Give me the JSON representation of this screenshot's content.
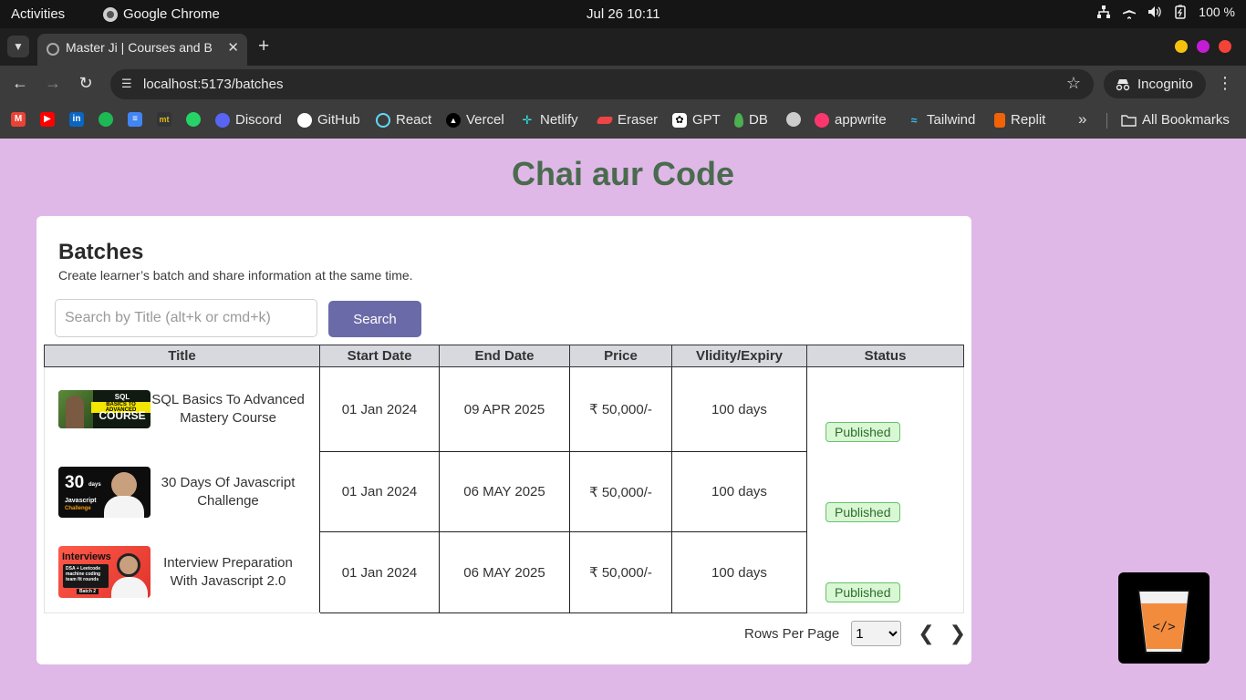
{
  "system": {
    "activities": "Activities",
    "app_name": "Google Chrome",
    "clock": "Jul 26  10:11",
    "battery": "100 %"
  },
  "browser": {
    "tab_title": "Master Ji | Courses and B",
    "url": "localhost:5173/batches",
    "incognito_label": "Incognito",
    "window_dot_colors": [
      "#f4c20d",
      "#c31cd4",
      "#f44336"
    ]
  },
  "bookmarks": {
    "items": [
      {
        "label": "Discord",
        "color": "#5865f2"
      },
      {
        "label": "GitHub",
        "color": "#ffffff"
      },
      {
        "label": "React",
        "color": "#61dafb"
      },
      {
        "label": "Vercel",
        "color": "#ffffff"
      },
      {
        "label": "Netlify",
        "color": "#32e6e2"
      },
      {
        "label": "Eraser",
        "color": "#ef4444"
      },
      {
        "label": "GPT",
        "color": "#ffffff"
      },
      {
        "label": "DB",
        "color": "#4caf50"
      },
      {
        "label": "appwrite",
        "color": "#fd366e"
      },
      {
        "label": "Tailwind",
        "color": "#38bdf8"
      },
      {
        "label": "Replit",
        "color": "#f26207"
      }
    ],
    "all_bookmarks": "All Bookmarks"
  },
  "page": {
    "brand_title": "Chai aur Code",
    "heading": "Batches",
    "subheading": "Create learner’s batch and share information at the same time.",
    "search": {
      "placeholder": "Search by Title (alt+k or cmd+k)",
      "value": "",
      "button_label": "Search"
    },
    "table": {
      "columns": [
        "Title",
        "Start Date",
        "End Date",
        "Price",
        "Vlidity/Expiry",
        "Status"
      ],
      "rows": [
        {
          "title": "SQL Basics To Advanced Mastery Course",
          "start": "01 Jan 2024",
          "end": "09 APR 2025",
          "price": "₹ 50,000/-",
          "validity": "100 days",
          "status": "Published"
        },
        {
          "title": "30 Days Of Javascript Challenge",
          "start": "01 Jan 2024",
          "end": "06 MAY 2025",
          "price": "₹ 50,000/-",
          "validity": "100 days",
          "status": "Published"
        },
        {
          "title": "Interview Preparation With Javascript 2.0",
          "start": "01 Jan 2024",
          "end": "06 MAY 2025",
          "price": "₹ 50,000/-",
          "validity": "100 days",
          "status": "Published"
        }
      ]
    },
    "pagination": {
      "rows_per_page_label": "Rows Per Page",
      "rows_per_page_value": "1"
    }
  },
  "thumbnails": {
    "sql": {
      "line1": "SQL",
      "line2": "BASICS TO ADVANCED",
      "line3": "COURSE"
    },
    "js30": {
      "big": "30",
      "small": "days",
      "line1": "Javascript",
      "line2": "Challenge"
    },
    "interviews": {
      "title": "Interviews",
      "line1": "DSA + Leetcode",
      "line2": "machine coding",
      "line3": "team fit rounds",
      "line4": "Batch 2"
    }
  }
}
